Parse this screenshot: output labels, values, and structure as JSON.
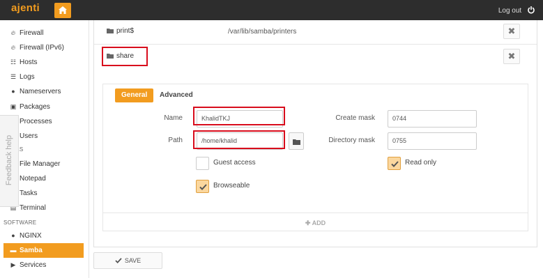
{
  "app": {
    "brand": "ajenti",
    "logout_label": "Log out"
  },
  "sidebar": {
    "items": [
      {
        "label": "Firewall",
        "icon": "fire-icon"
      },
      {
        "label": "Firewall (IPv6)",
        "icon": "fire-icon"
      },
      {
        "label": "Hosts",
        "icon": "sitemap-icon"
      },
      {
        "label": "Logs",
        "icon": "list-icon"
      },
      {
        "label": "Nameservers",
        "icon": "globe-icon"
      },
      {
        "label": "Packages",
        "icon": "gift-icon"
      },
      {
        "label": "Processes",
        "icon": "list-icon"
      },
      {
        "label": "Users",
        "icon": "users-icon"
      }
    ],
    "tools_section": "TOOLS",
    "tools_items": [
      {
        "label": "File Manager",
        "icon": "folder-icon"
      },
      {
        "label": "Notepad",
        "icon": "pencil-icon"
      },
      {
        "label": "Tasks",
        "icon": "cogs-icon"
      },
      {
        "label": "Terminal",
        "icon": "terminal-icon"
      }
    ],
    "software_section": "SOFTWARE",
    "software_items": [
      {
        "label": "NGINX",
        "icon": "globe-icon"
      },
      {
        "label": "Samba",
        "icon": "folder-icon",
        "active": true
      },
      {
        "label": "Services",
        "icon": "play-icon"
      }
    ]
  },
  "feedback": {
    "label": "Feedback help"
  },
  "shares": [
    {
      "name": "print$",
      "path": "/var/lib/samba/printers"
    },
    {
      "name": "share",
      "path": ""
    }
  ],
  "editor": {
    "tabs": [
      "General",
      "Advanced"
    ],
    "name_label": "Name",
    "name_value": "KhalidTKJ",
    "path_label": "Path",
    "path_value": "/home/khalid",
    "create_mask_label": "Create mask",
    "create_mask_value": "0744",
    "directory_mask_label": "Directory mask",
    "directory_mask_value": "0755",
    "guest_access_label": "Guest access",
    "guest_access_checked": false,
    "read_only_label": "Read only",
    "read_only_checked": true,
    "browseable_label": "Browseable",
    "browseable_checked": true
  },
  "add_label": "ADD",
  "save_label": "SAVE",
  "colors": {
    "accent": "#f29c1f",
    "topbar": "#2d2d2d",
    "highlight": "#d80c1c"
  }
}
